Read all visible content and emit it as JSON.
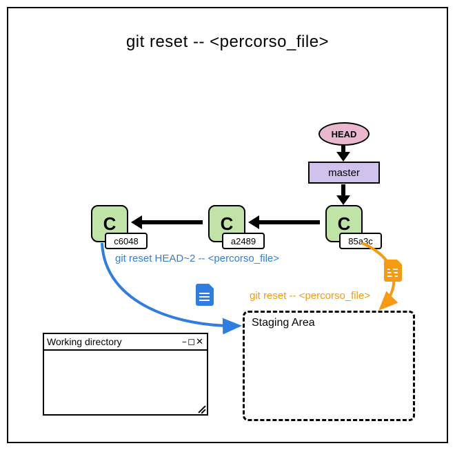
{
  "title": "git reset -- <percorso_file>",
  "head_ref": "HEAD",
  "branch": "master",
  "commits": [
    {
      "letter": "C",
      "hash": "c6048"
    },
    {
      "letter": "C",
      "hash": "a2489"
    },
    {
      "letter": "C",
      "hash": "85a3c"
    }
  ],
  "notes": {
    "blue": "git reset HEAD~2 -- <percorso_file>",
    "orange": "git reset -- <percorso_file>"
  },
  "staging_label": "Staging Area",
  "window": {
    "title": "Working directory",
    "controls": "–◻✕"
  },
  "colors": {
    "head_fill": "#e9b8cf",
    "branch_fill": "#d0c2ec",
    "commit_fill": "#c0e3a8",
    "blue": "#2f7de1",
    "orange": "#f59a11"
  }
}
